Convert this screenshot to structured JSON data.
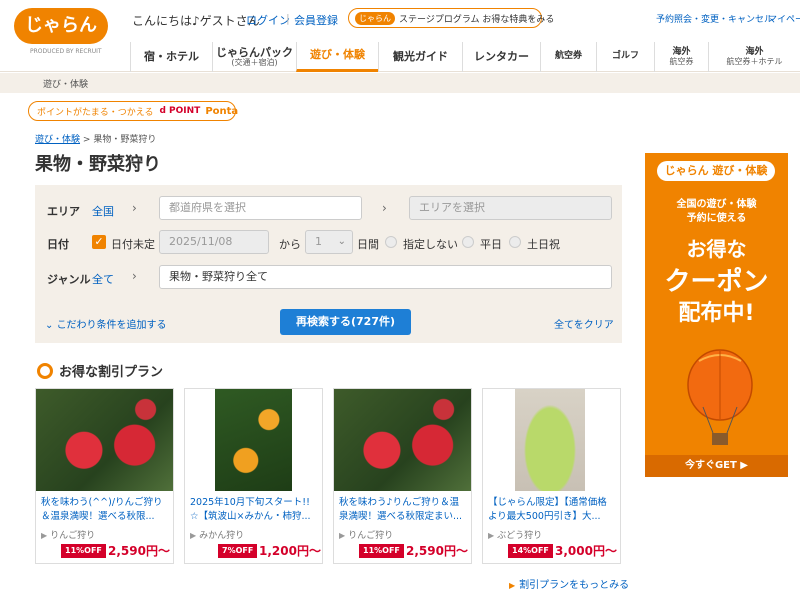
{
  "header": {
    "logo_text": "じゃらん",
    "logo_sub": "PRODUCED BY RECRUIT",
    "greeting": "こんにちは♪ゲストさん",
    "login": "ログイン",
    "register": "会員登録",
    "stage_badge": "じゃらん",
    "stage_text": "ステージプログラム お得な特典をみる",
    "util_reservation": "予約照会・変更・キャンセル",
    "util_mypage": "マイペー"
  },
  "nav": [
    {
      "label": "宿・ホテル",
      "sub": ""
    },
    {
      "label": "じゃらんパック",
      "sub": "(交通＋宿泊)"
    },
    {
      "label": "遊び・体験",
      "sub": ""
    },
    {
      "label": "観光ガイド",
      "sub": ""
    },
    {
      "label": "レンタカー",
      "sub": ""
    },
    {
      "label": "航空券",
      "sub": ""
    },
    {
      "label": "ゴルフ",
      "sub": ""
    },
    {
      "label": "海外",
      "sub": "航空券"
    },
    {
      "label": "海外",
      "sub": "航空券＋ホテル"
    }
  ],
  "crumbbar": "遊び・体験",
  "point_banner": {
    "text": "ポイントがたまる・つかえる",
    "dpoint": "d POINT",
    "ponta": "Ponta"
  },
  "breadcrumb": {
    "parent": "遊び・体験",
    "separator": ">",
    "current": "果物・野菜狩り"
  },
  "page_title": "果物・野菜狩り",
  "search": {
    "area_label": "エリア",
    "area_value": "全国",
    "arrow": "›",
    "pref_placeholder": "都道府県を選択",
    "area_placeholder": "エリアを選択",
    "date_label": "日付",
    "date_undecided": "日付未定",
    "date_value": "2025/11/08",
    "from": "から",
    "days_value": "1",
    "days_unit": "日間",
    "radio_none": "指定しない",
    "radio_weekday": "平日",
    "radio_weekend": "土日祝",
    "genre_label": "ジャンル",
    "genre_value": "全て",
    "genre_field": "果物・野菜狩り全て",
    "more_conditions": "こだわり条件を追加する",
    "search_button": "再検索する(727件)",
    "clear_all": "全てをクリア"
  },
  "deals": {
    "title": "お得な割引プラン",
    "cards": [
      {
        "title": "秋を味わう(^^)/りんご狩り＆温泉満喫！選べる秋限...",
        "category": "りんご狩り",
        "off": "11%OFF",
        "price": "2,590円〜"
      },
      {
        "title": "2025年10月下旬スタート!! ☆【筑波山×みかん・柿狩...",
        "category": "みかん狩り",
        "off": "7%OFF",
        "price": "1,200円〜"
      },
      {
        "title": "秋を味わう♪りんご狩り＆温泉満喫！選べる秋限定まい...",
        "category": "りんご狩り",
        "off": "11%OFF",
        "price": "2,590円〜"
      },
      {
        "title": "【じゃらん限定】【通常価格より最大500円引き】大...",
        "category": "ぶどう狩り",
        "off": "14%OFF",
        "price": "3,000円〜"
      }
    ],
    "more": "割引プランをもっとみる"
  },
  "ad": {
    "logo": "じゃらん 遊び・体験",
    "line1": "全国の遊び・体験",
    "line2": "予約に使える",
    "line3": "お得な",
    "line4": "クーポン",
    "line5": "配布中!",
    "cta": "今すぐGET ▶"
  }
}
